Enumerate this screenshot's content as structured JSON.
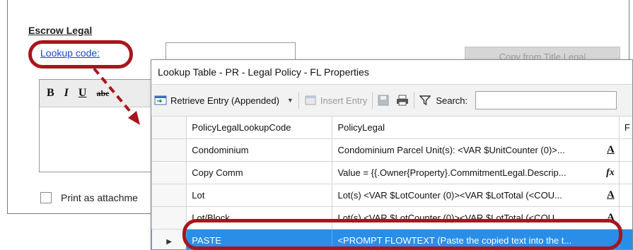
{
  "background": {
    "section_title": "Escrow Legal",
    "lookup_link": "Lookup code:",
    "copy_button": "Copy from Title Legal",
    "toolbar_bold": "B",
    "toolbar_italic": "I",
    "toolbar_underline": "U",
    "toolbar_strike": "abc",
    "print_label": "Print as attachme"
  },
  "window": {
    "title": "Lookup Table - PR - Legal Policy - FL Properties",
    "toolbar": {
      "retrieve": "Retrieve Entry (Appended)",
      "insert": "Insert Entry",
      "search_label": "Search:"
    },
    "columns": [
      "PolicyLegalLookupCode",
      "PolicyLegal",
      "F"
    ],
    "rows": [
      {
        "code": "Condominium",
        "legal": "Condominium Parcel Unit(s): <VAR $UnitCounter (0)>...",
        "icon": "A"
      },
      {
        "code": "Copy Comm",
        "legal": "Value = {{.Owner{Property}.CommitmentLegal.Descrip...",
        "icon": "fx"
      },
      {
        "code": "Lot",
        "legal": "Lot(s) <VAR $LotCounter (0)><VAR $LotTotal (<COU...",
        "icon": "A"
      },
      {
        "code": "Lot/Block",
        "legal": "Lot(s) <VAR $LotCounter (0)><VAR $LotTotal (<COU...",
        "icon": "A"
      },
      {
        "code": "PASTE",
        "legal": "<PROMPT FLOWTEXT (Paste the copied text into the t...",
        "icon": ""
      }
    ]
  },
  "colors": {
    "highlight": "#a8151d",
    "selection": "#2a8ee8",
    "link": "#1a47d6"
  }
}
